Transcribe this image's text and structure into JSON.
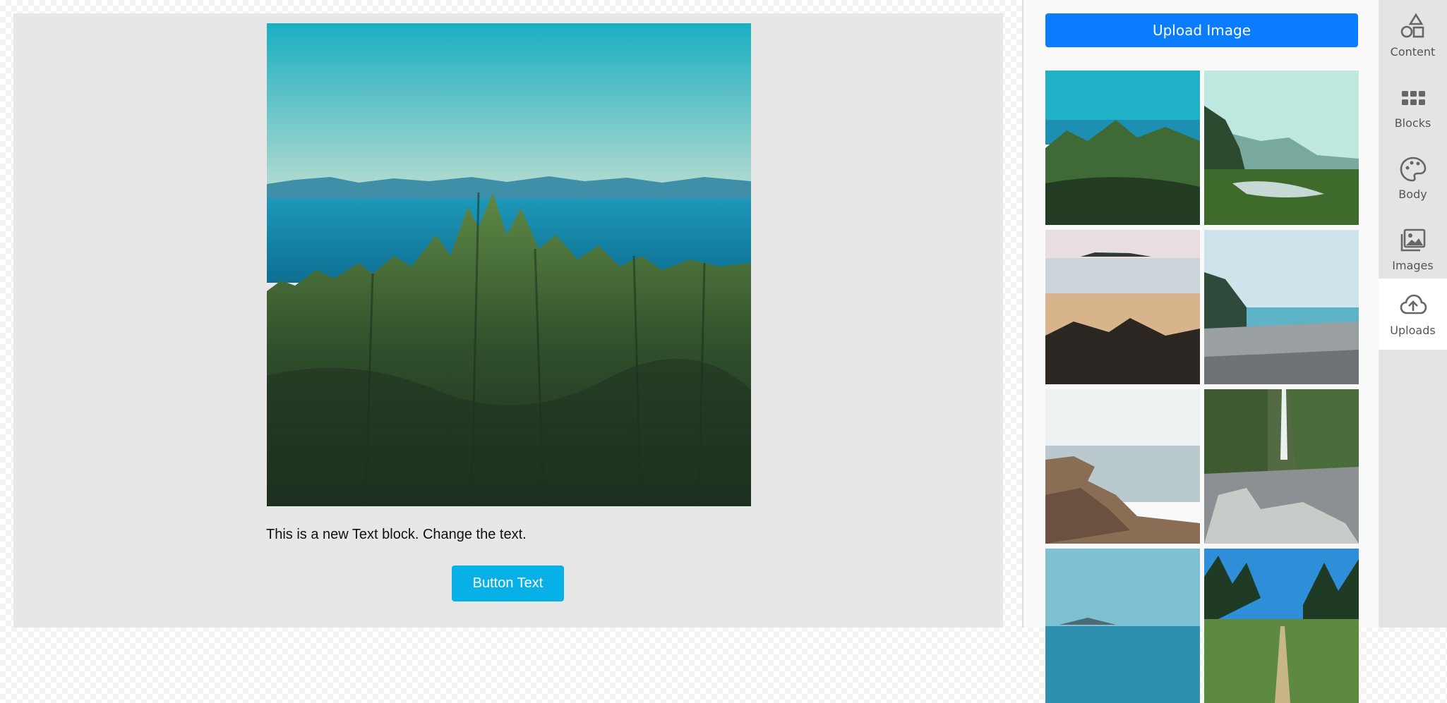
{
  "canvas": {
    "text_block": "This is a new Text block. Change the text.",
    "button_label": "Button Text",
    "button_color": "#07b0e6",
    "background_color": "#e7e7e7"
  },
  "uploads_panel": {
    "upload_button_label": "Upload Image",
    "upload_button_color": "#0a7cff",
    "thumbnails": [
      {
        "subject": "coastal forest with sea and mountains"
      },
      {
        "subject": "green valley with river and misty mountains"
      },
      {
        "subject": "sandy beach with dark rocks and island"
      },
      {
        "subject": "pebble shoreline with trees"
      },
      {
        "subject": "rocky shore with calm sea"
      },
      {
        "subject": "waterfall in rocky gorge"
      },
      {
        "subject": "blue sea with distant island"
      },
      {
        "subject": "forest path under blue sky"
      }
    ]
  },
  "sidebar": {
    "tabs": [
      {
        "label": "Content",
        "icon": "shapes-icon"
      },
      {
        "label": "Blocks",
        "icon": "grid-dots-icon"
      },
      {
        "label": "Body",
        "icon": "palette-icon"
      },
      {
        "label": "Images",
        "icon": "image-stack-icon"
      },
      {
        "label": "Uploads",
        "icon": "cloud-upload-icon"
      }
    ],
    "active_tab": "Uploads"
  }
}
